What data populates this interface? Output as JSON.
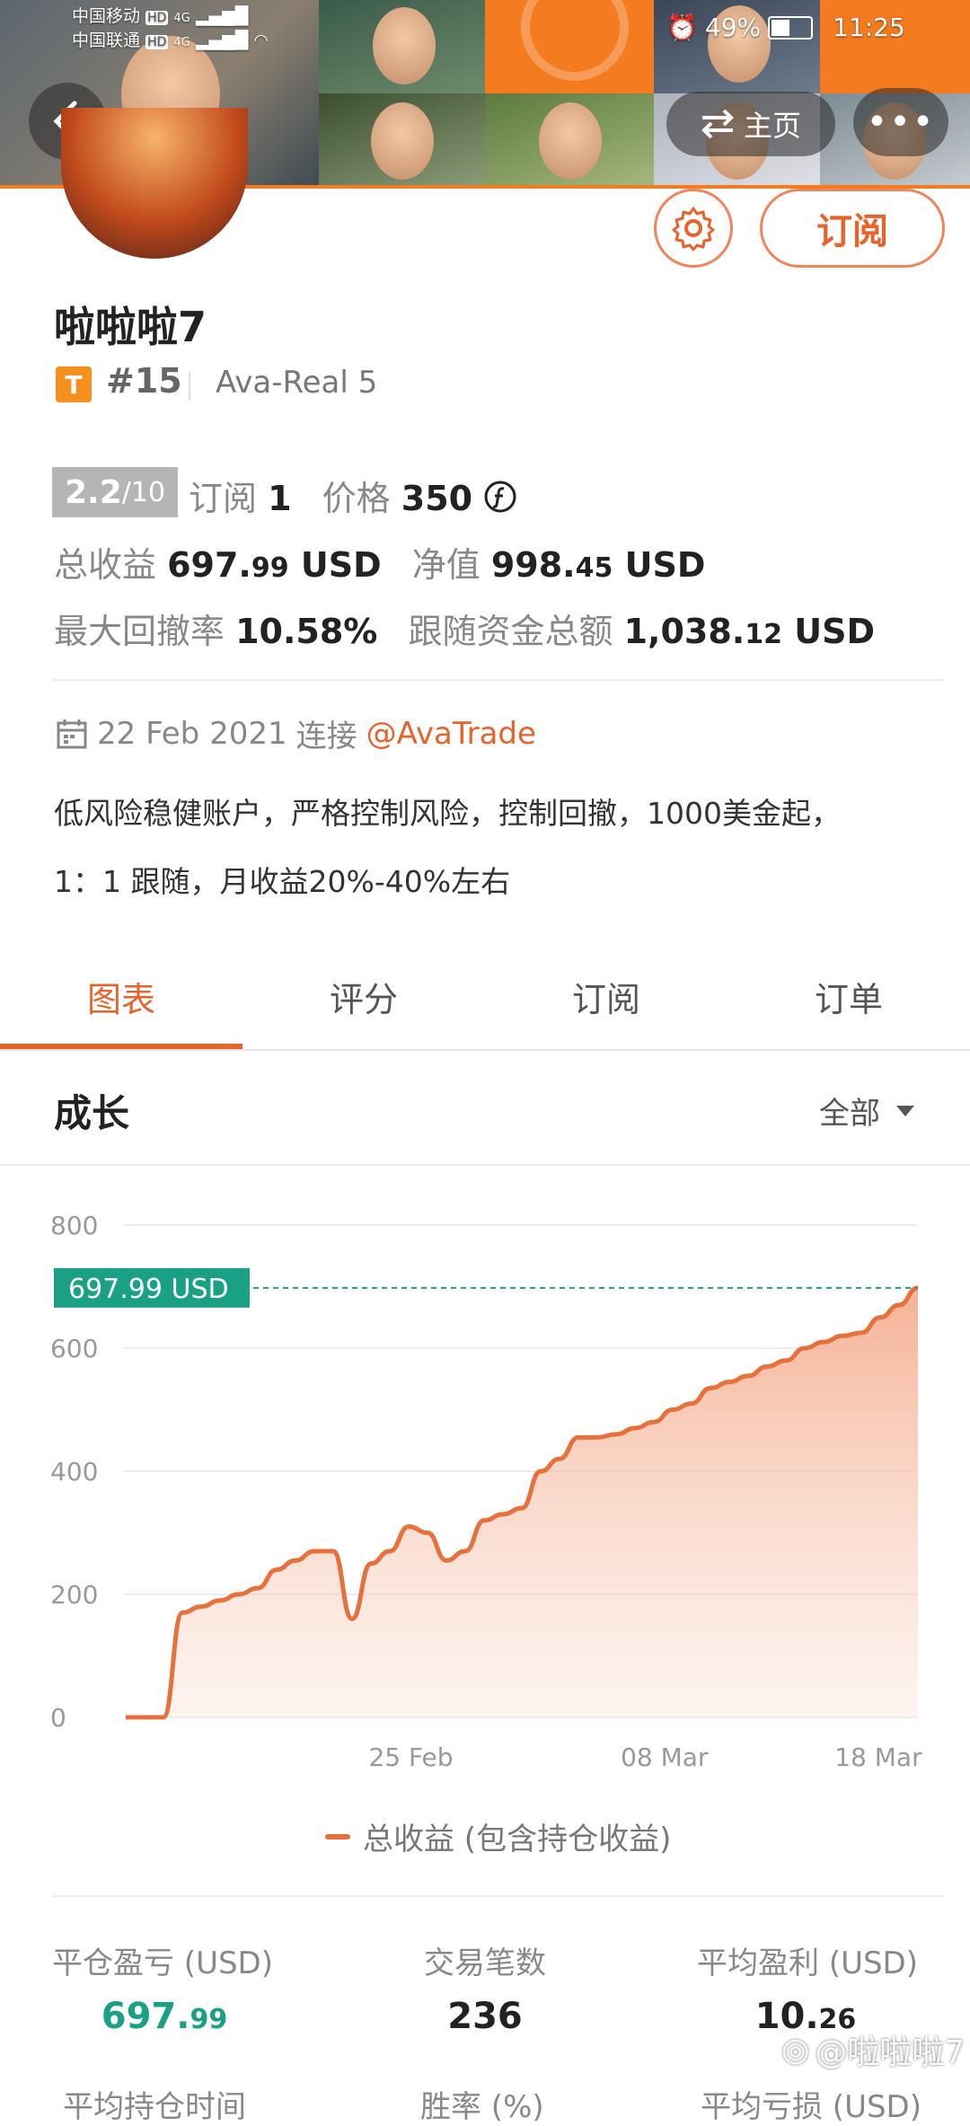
{
  "status_bar": {
    "carrier1": "中国移动",
    "carrier2": "中国联通",
    "network_hd": "HD",
    "network_4g": "4G",
    "battery": "49%",
    "time": "11:25"
  },
  "header": {
    "home_label": "主页",
    "more_label": "•••"
  },
  "profile": {
    "name": "啦啦啦7",
    "badge": "T",
    "rank": "#15",
    "account": "Ava-Real 5",
    "subscribe_label": "订阅"
  },
  "metrics": {
    "score_main": "2.2",
    "score_total": "/10",
    "subs_label": "订阅",
    "subs_value": "1",
    "price_label": "价格",
    "price_value": "350",
    "total_profit_label": "总收益",
    "total_profit_int": "697.",
    "total_profit_dec": "99",
    "total_profit_unit": "USD",
    "equity_label": "净值",
    "equity_int": "998.",
    "equity_dec": "45",
    "equity_unit": "USD",
    "drawdown_label": "最大回撤率",
    "drawdown_value": "10.58%",
    "follow_label": "跟随资金总额",
    "follow_int": "1,038.",
    "follow_dec": "12",
    "follow_unit": "USD"
  },
  "info": {
    "date": "22 Feb 2021",
    "connect_label": "连接",
    "broker": "@AvaTrade",
    "desc_line1": "低风险稳健账户，严格控制风险，控制回撤，1000美金起，",
    "desc_line2": "1：1 跟随，月收益20%-40%左右"
  },
  "tabs": [
    "图表",
    "评分",
    "订阅",
    "订单"
  ],
  "growth": {
    "title": "成长",
    "filter": "全部"
  },
  "chart_data": {
    "type": "area",
    "ylim": [
      0,
      800
    ],
    "yticks": [
      "800",
      "600",
      "400",
      "200",
      "0"
    ],
    "xtick_labels": [
      "25 Feb",
      "08 Mar",
      "18 Mar"
    ],
    "current_value_label": "697.99 USD",
    "current_value": 697.99,
    "series": [
      {
        "name": "总收益 (包含持仓收益)",
        "color": "#e8703a",
        "values": [
          0,
          0,
          0,
          170,
          180,
          190,
          200,
          210,
          240,
          255,
          270,
          270,
          160,
          250,
          270,
          310,
          300,
          255,
          270,
          320,
          330,
          340,
          400,
          420,
          455,
          455,
          460,
          470,
          480,
          500,
          510,
          535,
          545,
          555,
          570,
          580,
          600,
          610,
          620,
          625,
          650,
          670,
          697.99
        ]
      }
    ]
  },
  "legend": "总收益 (包含持仓收益)",
  "stats": {
    "closed_pl_label": "平仓盈亏 (USD)",
    "closed_pl_int": "697.",
    "closed_pl_dec": "99",
    "trades_label": "交易笔数",
    "trades_value": "236",
    "avg_profit_label": "平均盈利 (USD)",
    "avg_profit_int": "10.",
    "avg_profit_dec": "26",
    "row2_label1": "平均持仓时间",
    "row2_label2": "胜率 (%)",
    "row2_label3": "平均亏损 (USD)"
  },
  "watermark": "@啦啦啦7",
  "colors": {
    "accent": "#e8632a",
    "teal": "#1aa085"
  }
}
